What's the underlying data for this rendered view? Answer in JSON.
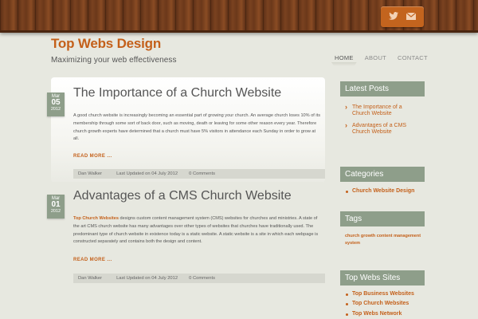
{
  "header": {
    "social_icons": [
      "twitter-icon",
      "mail-icon"
    ],
    "accent_color": "#c3641e"
  },
  "site": {
    "title": "Top Webs Design",
    "tagline": "Maximizing your web effectiveness"
  },
  "nav": {
    "items": [
      "HOME",
      "ABOUT",
      "CONTACT"
    ],
    "active": "HOME"
  },
  "posts": [
    {
      "date": {
        "month": "Mar",
        "day": "05",
        "year": "2012"
      },
      "title_pre": "The ",
      "title_main": "Importance of a Church Website",
      "body": "A good church website is increasingly becoming an essential part of growing your church. An average church loses 10% of its membership through some sort of back door, such as moving, death or leaving for some other reason every year. Therefore church growth experts have determined that a church must have 5% visitors in attendance each Sunday in order to grow at all.",
      "read_more": "READ MORE ...",
      "author": "Dan Walker",
      "updated": "Last Updated on 04 July 2012",
      "comments": "0 Comments"
    },
    {
      "date": {
        "month": "Mar",
        "day": "01",
        "year": "2012"
      },
      "title_pre": "Advantages",
      "title_main": " of a CMS Church Website",
      "body_highlight": "Top Church Websites",
      "body": " designs custom content management system (CMS) websites for churches and ministries. A state of the art CMS church website has many advantages over other types of websites that churches have traditionally used. The predominant type of church website in existence today is a static website. A static website is a site in which each webpage is constructed separately and contains both the design and content.",
      "read_more": "READ MORE ...",
      "author": "Dan Walker",
      "updated": "Last Updated on 04 July 2012",
      "comments": "0 Comments"
    }
  ],
  "sidebar": {
    "latest_posts": {
      "heading": "Latest Posts",
      "items": [
        "The Importance of a Church Website",
        "Advantages of a CMS Church Website"
      ]
    },
    "categories": {
      "heading": "Categories",
      "items": [
        "Church Website Design"
      ]
    },
    "tags": {
      "heading": "Tags",
      "items": [
        "church growth content management system"
      ]
    },
    "top_webs_sites": {
      "heading": "Top Webs Sites",
      "items": [
        "Top Business Websites",
        "Top Church Websites",
        "Top Webs Network"
      ]
    }
  }
}
